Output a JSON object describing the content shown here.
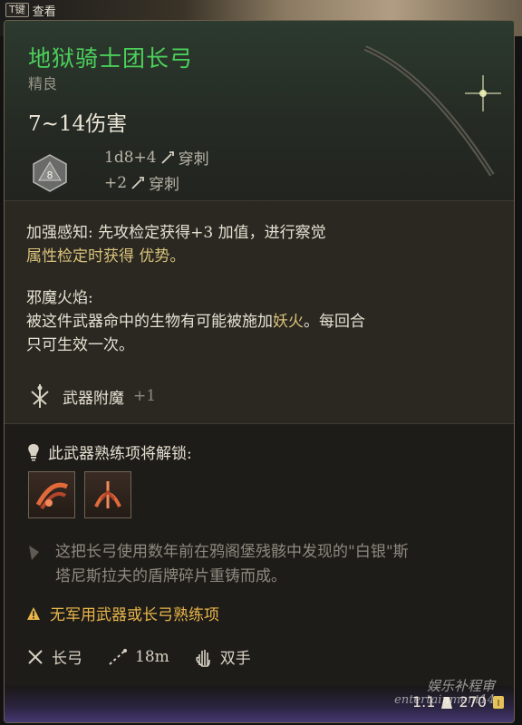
{
  "topbar": {
    "key": "T键",
    "view_label": "查看"
  },
  "item": {
    "name": "地狱骑士团长弓",
    "rarity": "精良",
    "damage": "7~14伤害",
    "die_value": "8",
    "damage_lines": [
      {
        "formula": "1d8+4",
        "type": "穿刺"
      },
      {
        "formula": "+2",
        "type": "穿刺"
      }
    ]
  },
  "passives": {
    "p1_line1_a": "加强感知: 先攻检定获得+3 加值，进行察觉",
    "p1_line2_a": "属性检定时获得 ",
    "p1_line2_b": "优势",
    "p1_line2_c": "。",
    "p2_title": "邪魔火焰:",
    "p2_line1_a": "被这件武器命中的生物有可能被施加",
    "p2_line1_b": "妖火",
    "p2_line1_c": "。每回合",
    "p2_line2": "只可生效一次。",
    "enchant_label": "武器附魔",
    "enchant_value": "+1"
  },
  "proficiency": {
    "unlock_label": "此武器熟练项将解锁:",
    "skills": [
      "skill-icon-1",
      "skill-icon-2"
    ]
  },
  "lore": {
    "line1": "这把长弓使用数年前在鸦阁堡残骸中发现的\"白银\"斯",
    "line2": "塔尼斯拉夫的盾牌碎片重铸而成。"
  },
  "warning": {
    "text": "无军用武器或长弓熟练项"
  },
  "properties": {
    "weapon_type": "长弓",
    "range": "18m",
    "handedness": "双手"
  },
  "footer": {
    "weight": "1.1",
    "price": "270"
  },
  "watermark": {
    "line1": "娱乐补程审",
    "line2": "entertainment14"
  },
  "colors": {
    "title_green": "#4bd05a",
    "gold_text": "#d9c27a",
    "warning": "#e8b54a",
    "footer_purple": "#4a3a78"
  }
}
